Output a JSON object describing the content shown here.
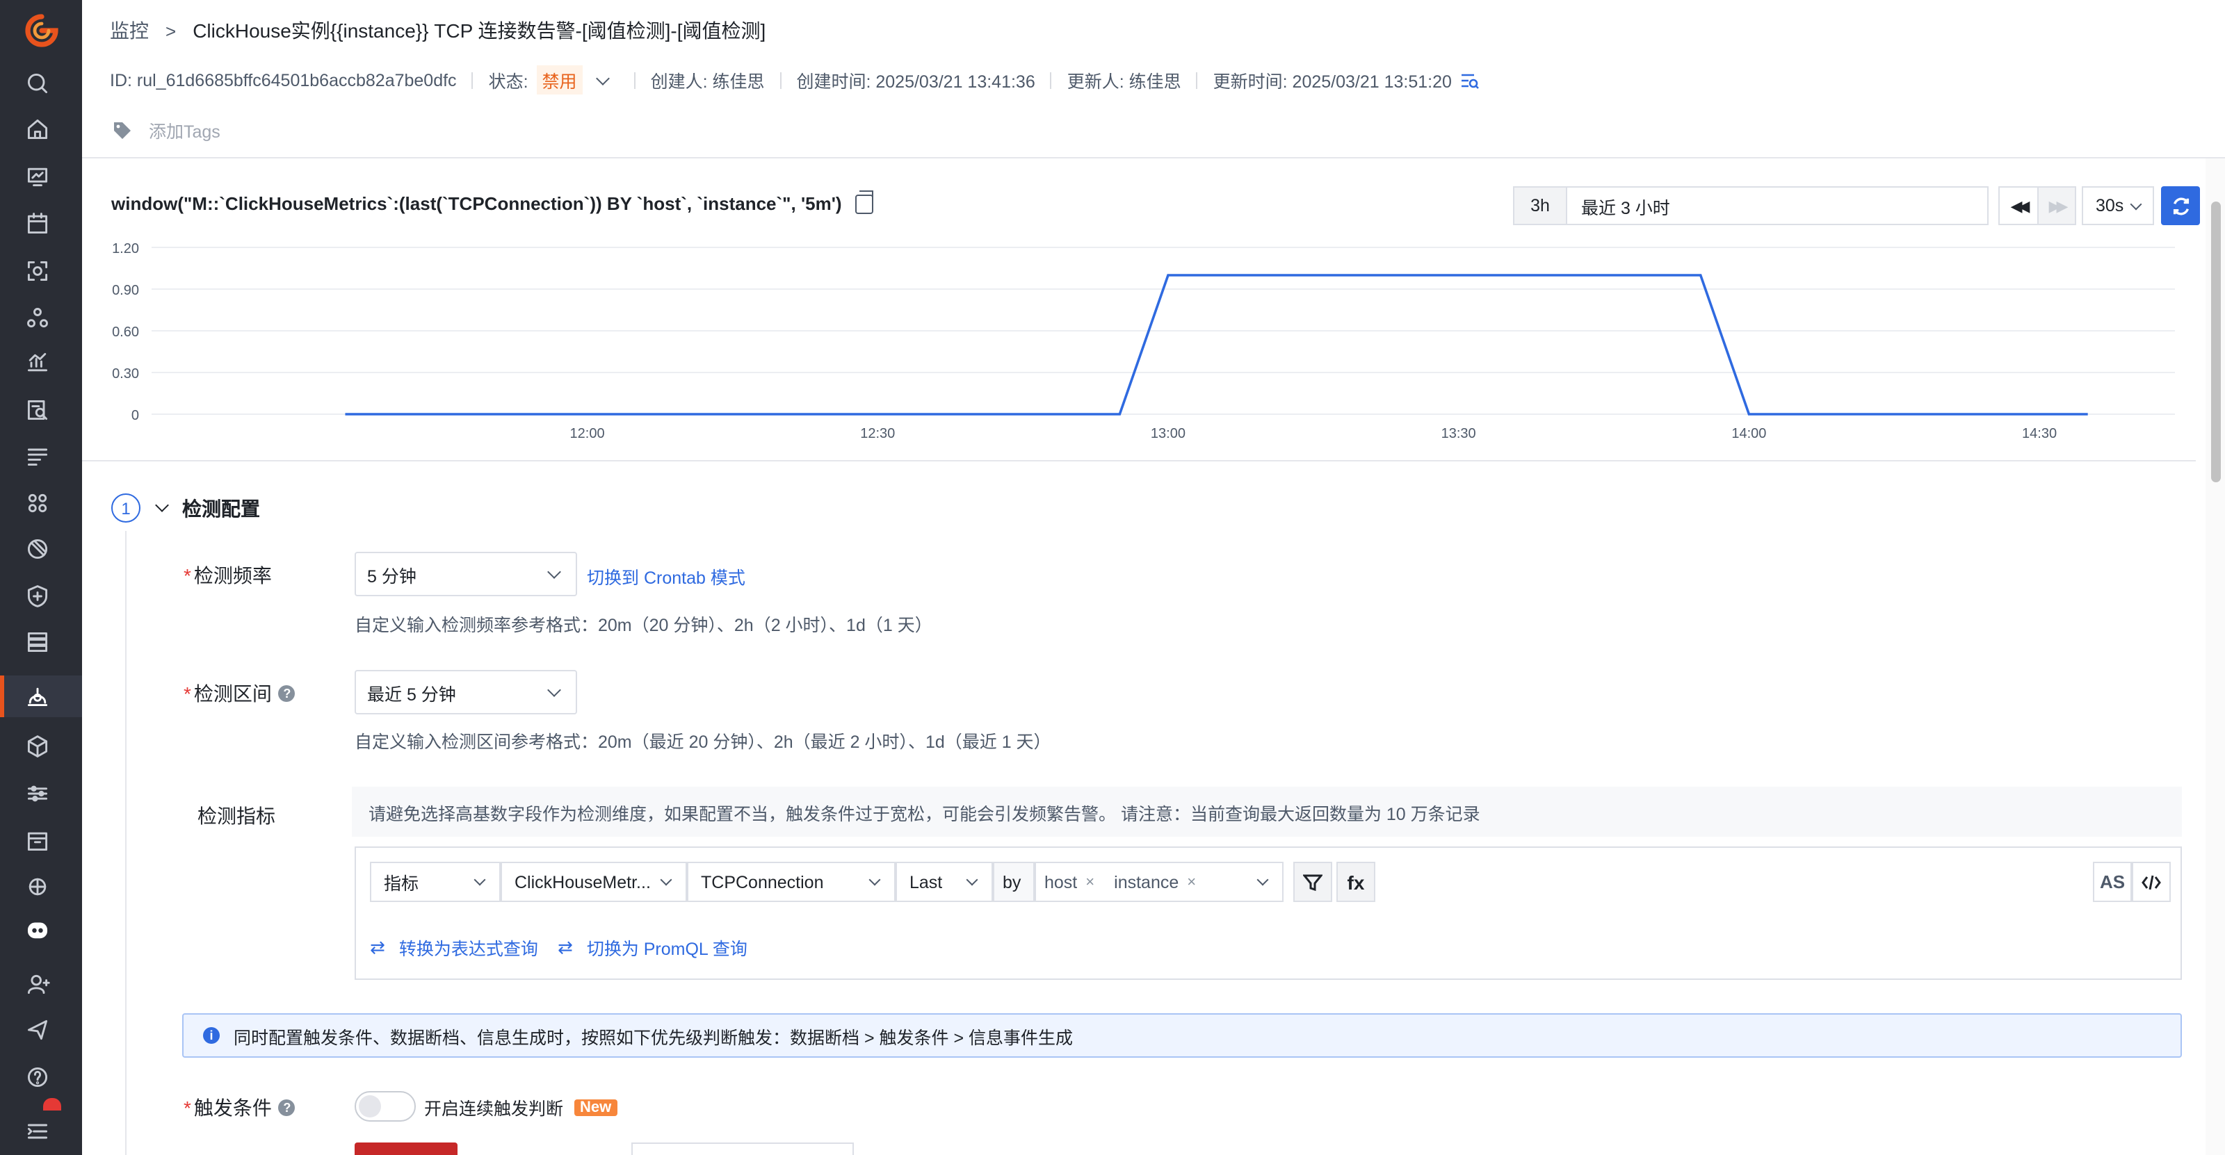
{
  "breadcrumb": {
    "root": "监控",
    "title": "ClickHouse实例{{instance}} TCP 连接数告警-[阈值检测]-[阈值检测]"
  },
  "meta": {
    "id": "ID: rul_61d6685bffc64501b6accb82a7be0dfc",
    "status_label": "状态:",
    "status_value": "禁用",
    "creator": "创建人: 练佳思",
    "created_at": "创建时间: 2025/03/21 13:41:36",
    "updater": "更新人: 练佳思",
    "updated_at": "更新时间: 2025/03/21 13:51:20"
  },
  "tags": {
    "placeholder": "添加Tags"
  },
  "query": {
    "text": "window(\"M::`ClickHouseMetrics`:(last(`TCPConnection`)) BY `host`, `instance`\", '5m')"
  },
  "time_range": {
    "short": "3h",
    "label": "最近 3 小时",
    "refresh_interval": "30s"
  },
  "chart_data": {
    "type": "line",
    "x": [
      "11:35",
      "12:00",
      "12:30",
      "12:55",
      "13:00",
      "13:55",
      "14:00",
      "14:30",
      "14:35"
    ],
    "series": [
      {
        "values": [
          0,
          0,
          0,
          0,
          1,
          1,
          0,
          0,
          0
        ]
      }
    ],
    "x_ticks": [
      "12:00",
      "12:30",
      "13:00",
      "13:30",
      "14:00",
      "14:30"
    ],
    "y_ticks": [
      "0",
      "0.30",
      "0.60",
      "0.90",
      "1.20"
    ],
    "ylim": [
      0,
      1.2
    ],
    "grid": true,
    "line_color": "#2f6ae0"
  },
  "section": {
    "number": "1",
    "title": "检测配置"
  },
  "frequency": {
    "label": "检测频率",
    "value": "5 分钟",
    "switch_link": "切换到 Crontab 模式",
    "hint": "自定义输入检测频率参考格式：20m（20 分钟）、2h（2 小时）、1d（1 天）"
  },
  "interval": {
    "label": "检测区间",
    "value": "最近 5 分钟",
    "hint": "自定义输入检测区间参考格式：20m（最近 20 分钟）、2h（最近 2 小时）、1d（最近 1 天）"
  },
  "metric": {
    "label": "检测指标",
    "note": "请避免选择高基数字段作为检测维度，如果配置不当，触发条件过于宽松，可能会引发频繁告警。 请注意：当前查询最大返回数量为 10 万条记录",
    "type": "指标",
    "measurement": "ClickHouseMetr...",
    "field": "TCPConnection",
    "func": "Last",
    "by": "by",
    "group_tags": [
      "host",
      "instance"
    ],
    "as_label": "AS",
    "fx_label": "fx",
    "convert_expr": "转换为表达式查询",
    "convert_promql": "切换为 PromQL 查询"
  },
  "info": {
    "text": "同时配置触发条件、数据断档、信息生成时，按照如下优先级判断触发：数据断档 > 触发条件 > 信息事件生成"
  },
  "trigger": {
    "label": "触发条件",
    "toggle_label": "开启连续触发判断",
    "new_badge": "New"
  },
  "colors": {
    "sidebar": "#2a2d35",
    "accent": "#2f6ae0",
    "brand": "#e8531d",
    "status_disabled": "#e8631d"
  }
}
